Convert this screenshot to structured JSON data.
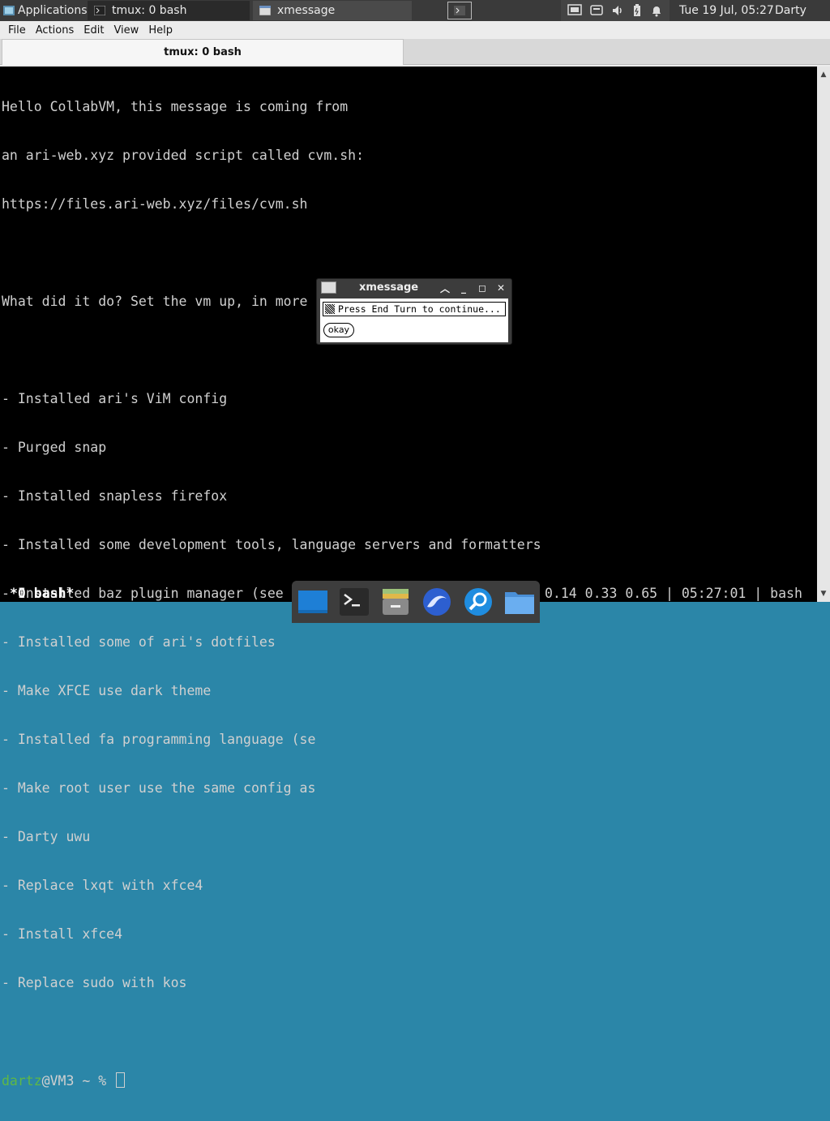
{
  "panel": {
    "applications_label": "Applications",
    "tasks": [
      {
        "label": "tmux: 0 bash"
      },
      {
        "label": "xmessage"
      }
    ],
    "clock": "Tue 19 Jul, 05:27",
    "user": "Darty uwu"
  },
  "window": {
    "menu": [
      "File",
      "Actions",
      "Edit",
      "View",
      "Help"
    ],
    "tab_title": "tmux: 0 bash"
  },
  "terminal": {
    "lines": [
      "Hello CollabVM, this message is coming from",
      "an ari-web.xyz provided script called cvm.sh:",
      "https://files.ari-web.xyz/files/cvm.sh",
      "",
      "What did it do? Set the vm up, in more detail:",
      "",
      "- Installed ari's ViM config",
      "- Purged snap",
      "- Installed snapless firefox",
      "- Installed some development tools, language servers and formatters",
      "- Installed baz plugin manager (see `baz help`)",
      "- Installed some of ari's dotfiles",
      "- Make XFCE use dark theme",
      "- Installed fa programming language (se",
      "- Make root user use the same config as",
      "- Darty uwu",
      "- Replace lxqt with xfce4",
      "- Install xfce4",
      "- Replace sudo with kos",
      ""
    ],
    "prompt_user": "dartz",
    "prompt_rest": "@VM3 ~ % ",
    "status_left": "*0 bash*",
    "status_right": "0.14 0.33 0.65 | 05:27:01 | bash"
  },
  "xmessage": {
    "title": "xmessage",
    "message": "Press End Turn to continue...",
    "button": "okay"
  },
  "dock": {
    "items": [
      "desktop-icon",
      "terminal-icon",
      "archive-icon",
      "browser-icon",
      "search-icon",
      "folder-icon"
    ]
  }
}
